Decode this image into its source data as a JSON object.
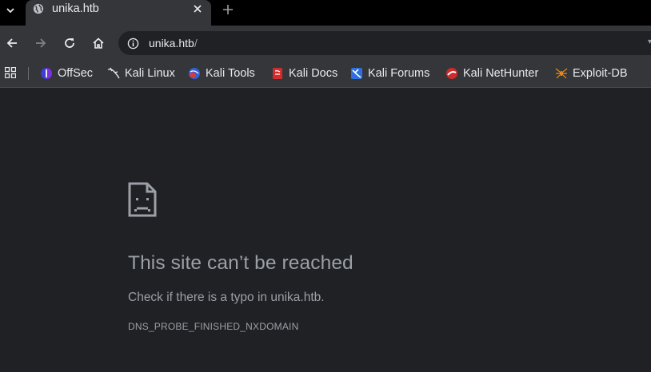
{
  "colors": {
    "page_background": "#202124",
    "toolbar_background": "#35363a",
    "tabstrip_background": "#000000",
    "text_primary": "#e8eaed",
    "text_secondary": "#9aa0a6"
  },
  "tab": {
    "title": "unika.htb",
    "favicon": "globe-icon"
  },
  "toolbar": {
    "url_host": "unika.htb",
    "url_path": "/"
  },
  "bookmarks": [
    {
      "label": "OffSec",
      "icon": "offsec-icon"
    },
    {
      "label": "Kali Linux",
      "icon": "kali-dragon-icon"
    },
    {
      "label": "Kali Tools",
      "icon": "kali-tools-icon"
    },
    {
      "label": "Kali Docs",
      "icon": "kali-docs-icon"
    },
    {
      "label": "Kali Forums",
      "icon": "kali-forums-icon"
    },
    {
      "label": "Kali NetHunter",
      "icon": "kali-nethunter-icon"
    },
    {
      "label": "Exploit-DB",
      "icon": "exploit-db-icon"
    }
  ],
  "error": {
    "title": "This site can’t be reached",
    "description": "Check if there is a typo in unika.htb.",
    "code": "DNS_PROBE_FINISHED_NXDOMAIN"
  }
}
